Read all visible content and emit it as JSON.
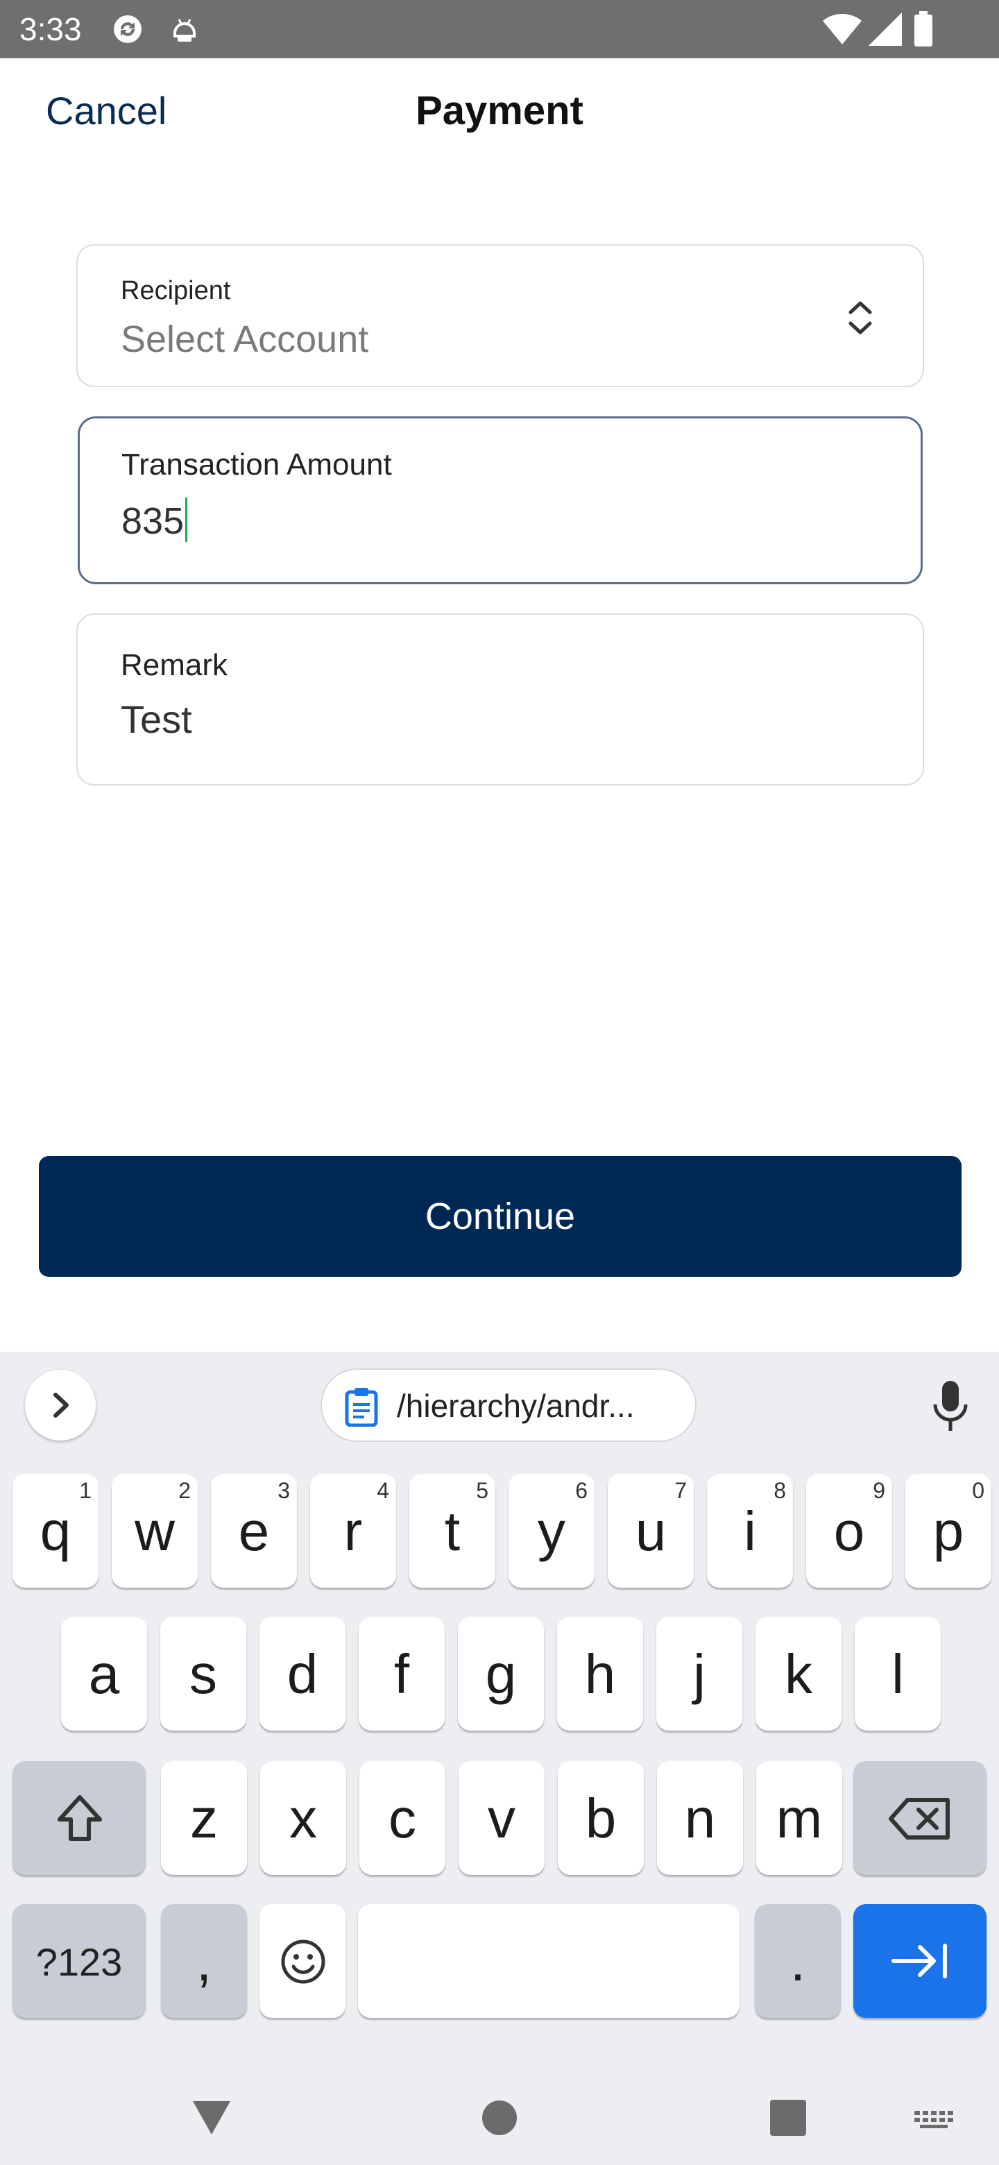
{
  "status_bar": {
    "time": "3:33",
    "left_icons": [
      "sync-icon",
      "android-debug-icon"
    ],
    "right_icons": [
      "wifi-icon",
      "signal-icon",
      "battery-icon"
    ]
  },
  "header": {
    "cancel_label": "Cancel",
    "title": "Payment"
  },
  "form": {
    "recipient": {
      "label": "Recipient",
      "placeholder": "Select Account",
      "icon": "chevron-updown-icon"
    },
    "amount": {
      "label": "Transaction Amount",
      "value": "835"
    },
    "remark": {
      "label": "Remark",
      "value": "Test"
    }
  },
  "continue_label": "Continue",
  "keyboard": {
    "clipboard_text": "/hierarchy/andr...",
    "row1": [
      {
        "ch": "q",
        "hint": "1"
      },
      {
        "ch": "w",
        "hint": "2"
      },
      {
        "ch": "e",
        "hint": "3"
      },
      {
        "ch": "r",
        "hint": "4"
      },
      {
        "ch": "t",
        "hint": "5"
      },
      {
        "ch": "y",
        "hint": "6"
      },
      {
        "ch": "u",
        "hint": "7"
      },
      {
        "ch": "i",
        "hint": "8"
      },
      {
        "ch": "o",
        "hint": "9"
      },
      {
        "ch": "p",
        "hint": "0"
      }
    ],
    "row2": [
      "a",
      "s",
      "d",
      "f",
      "g",
      "h",
      "j",
      "k",
      "l"
    ],
    "row3": [
      "z",
      "x",
      "c",
      "v",
      "b",
      "n",
      "m"
    ],
    "symbols_label": "?123",
    "comma_label": ",",
    "period_label": "."
  },
  "colors": {
    "primary": "#002855",
    "status_bar": "#6f6f6f",
    "enter_key": "#1a73e8",
    "caret": "#1faa4a"
  }
}
